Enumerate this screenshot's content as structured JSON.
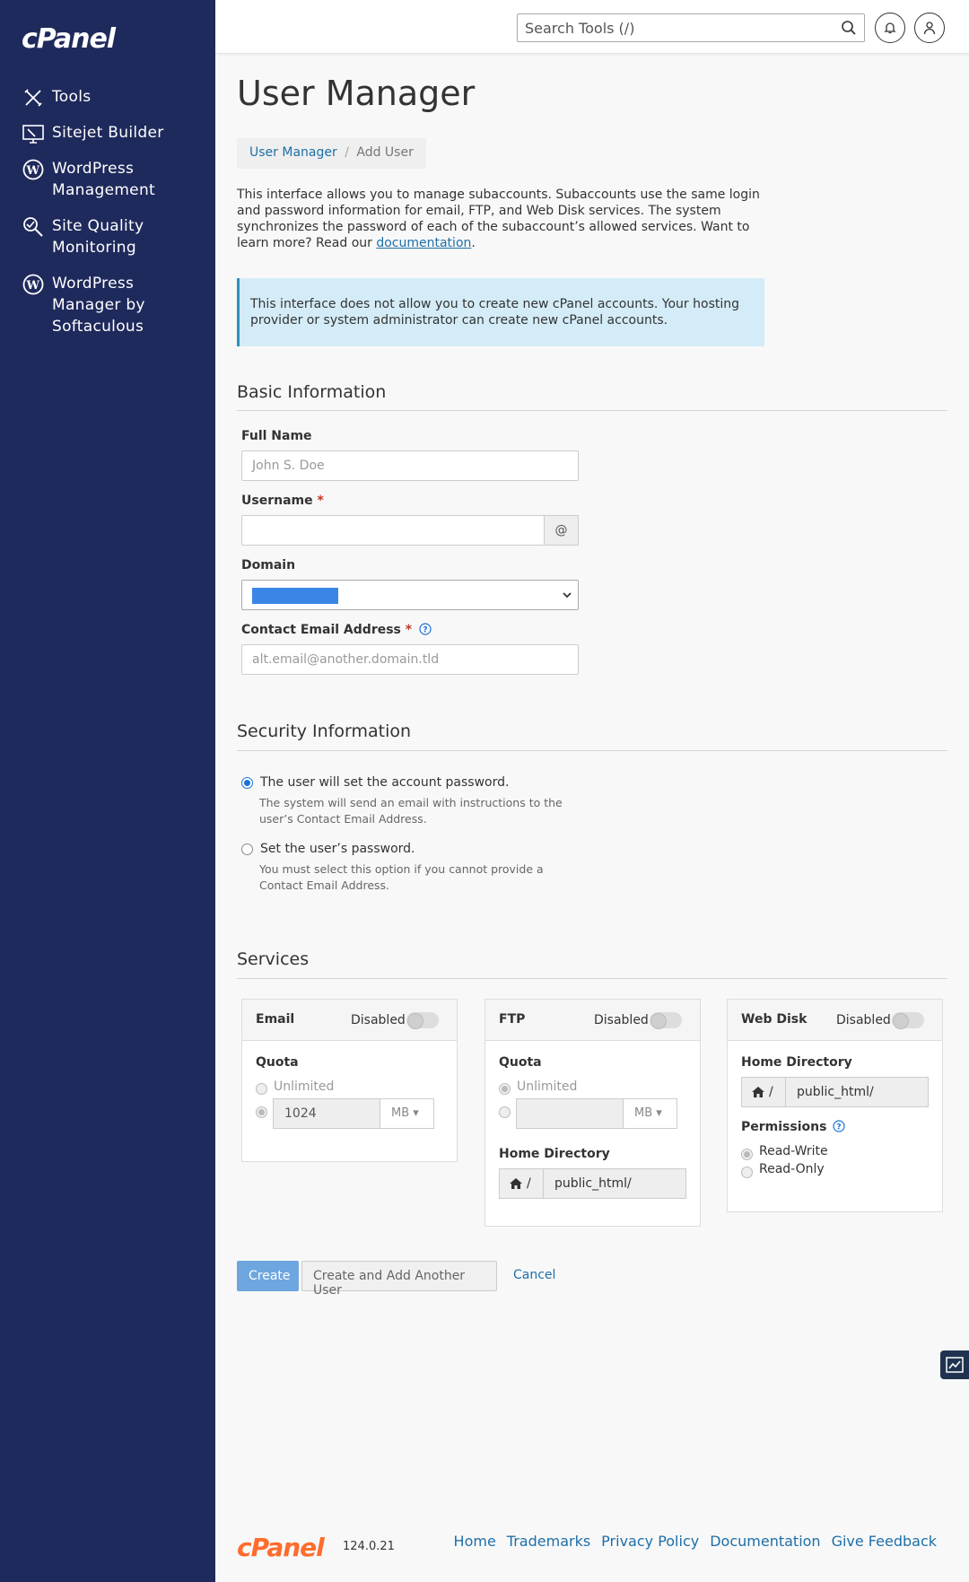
{
  "sidebar": {
    "logo": "cPanel",
    "items": [
      {
        "label": "Tools",
        "icon": "tools-icon"
      },
      {
        "label": "Sitejet Builder",
        "icon": "sitejet-icon"
      },
      {
        "label": "WordPress Management",
        "icon": "wordpress-icon"
      },
      {
        "label": "Site Quality Monitoring",
        "icon": "site-quality-icon"
      },
      {
        "label": "WordPress Manager by Softaculous",
        "icon": "wordpress-icon"
      }
    ]
  },
  "header": {
    "search_placeholder": "Search Tools (/)"
  },
  "page": {
    "title": "User Manager",
    "breadcrumb": {
      "parent": "User Manager",
      "separator": "/",
      "current": "Add User"
    },
    "intro_text": "This interface allows you to manage subaccounts. Subaccounts use the same login and password information for email, FTP, and Web Disk services. The system synchronizes the password of each of the subaccount’s allowed services. Want to learn more? Read our ",
    "intro_link": "documentation",
    "intro_end": ".",
    "alert": "This interface does not allow you to create new cPanel accounts. Your hosting provider or system administrator can create new cPanel accounts."
  },
  "basic": {
    "title": "Basic Information",
    "full_name_label": "Full Name",
    "full_name_placeholder": "John S. Doe",
    "username_label": "Username",
    "required_mark": "*",
    "at_sign": "@",
    "domain_label": "Domain",
    "contact_label": "Contact Email Address",
    "contact_placeholder": "alt.email@another.domain.tld"
  },
  "security": {
    "title": "Security Information",
    "option1": "The user will set the account password.",
    "option1_help": "The system will send an email with instructions to the user’s Contact Email Address.",
    "option2": "Set the user’s password.",
    "option2_help": "You must select this option if you cannot provide a Contact Email Address."
  },
  "services": {
    "title": "Services",
    "email": {
      "title": "Email",
      "status": "Disabled",
      "quota_label": "Quota",
      "unlimited": "Unlimited",
      "quota_value": "1024",
      "unit": "MB"
    },
    "ftp": {
      "title": "FTP",
      "status": "Disabled",
      "quota_label": "Quota",
      "unlimited": "Unlimited",
      "unit": "MB",
      "home_label": "Home Directory",
      "home_prefix": "/",
      "home_value": "public_html/"
    },
    "webdisk": {
      "title": "Web Disk",
      "status": "Disabled",
      "home_label": "Home Directory",
      "home_prefix": "/",
      "home_value": "public_html/",
      "perm_label": "Permissions",
      "perm_rw": "Read-Write",
      "perm_ro": "Read-Only"
    }
  },
  "actions": {
    "create": "Create",
    "create_another": "Create and Add Another User",
    "cancel": "Cancel"
  },
  "footer": {
    "logo": "cPanel",
    "version": "124.0.21",
    "links": [
      "Home",
      "Trademarks",
      "Privacy Policy",
      "Documentation",
      "Give Feedback"
    ]
  },
  "colors": {
    "sidebar": "#1f2a5c",
    "accent": "#1d6fa8",
    "brand_orange": "#ff6c2c"
  }
}
